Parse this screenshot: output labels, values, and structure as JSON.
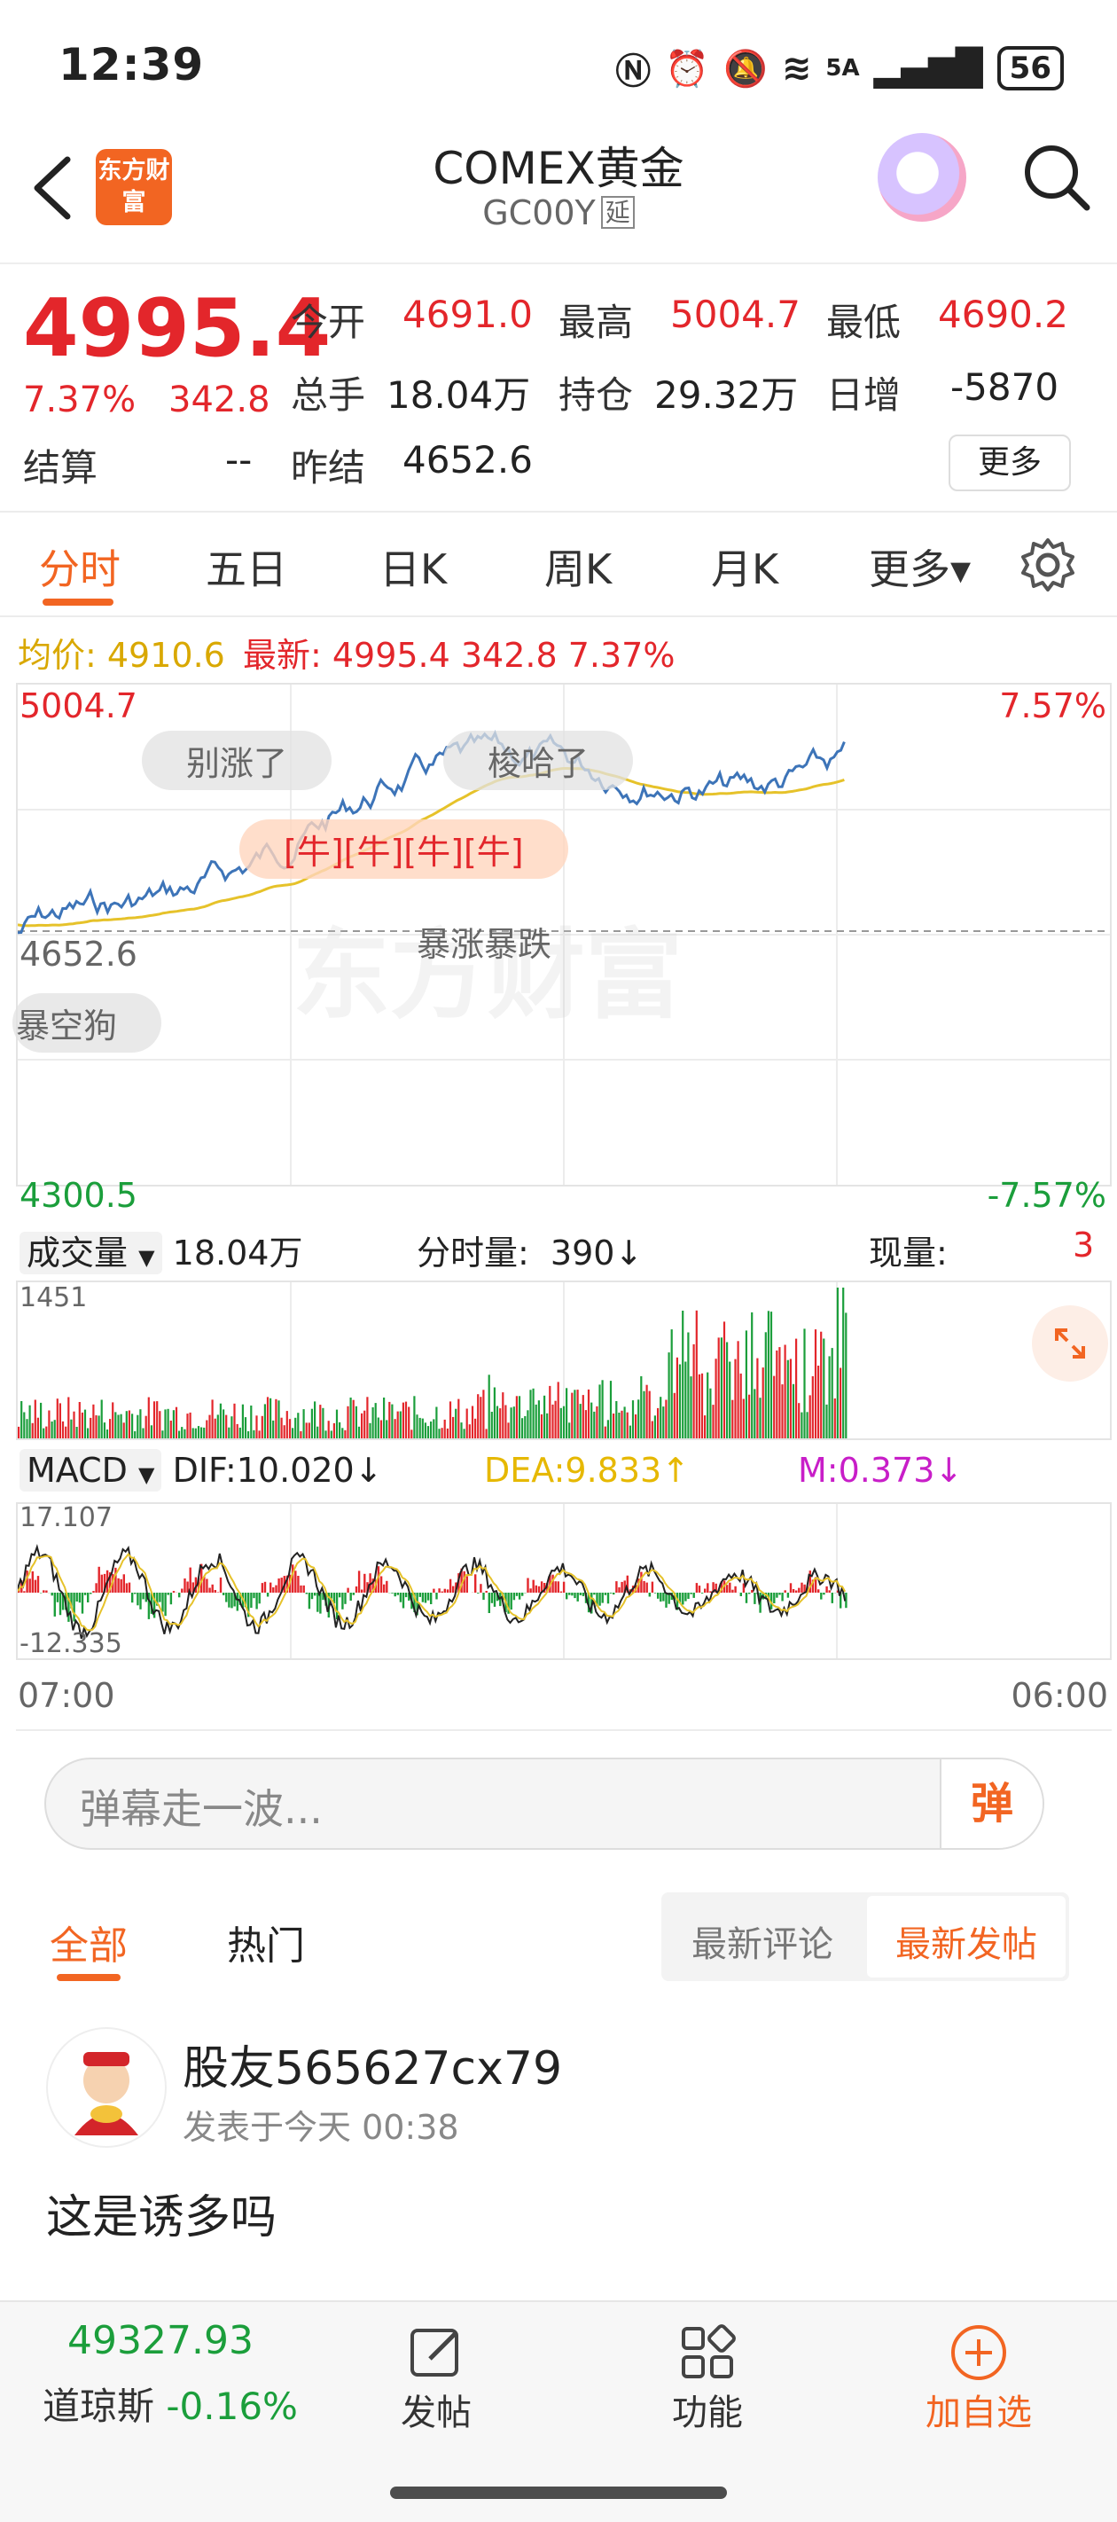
{
  "status_bar": {
    "time": "12:39",
    "network": "5A",
    "battery": "56"
  },
  "header": {
    "logo_text": "东方财富",
    "title": "COMEX黄金",
    "code": "GC00Y",
    "delay_badge": "延"
  },
  "quote": {
    "price": "4995.4",
    "change_pct": "7.37%",
    "change_amt": "342.8",
    "open_label": "今开",
    "open": "4691.0",
    "high_label": "最高",
    "high": "5004.7",
    "low_label": "最低",
    "low": "4690.2",
    "volume_label": "总手",
    "volume": "18.04万",
    "oi_label": "持仓",
    "oi": "29.32万",
    "daily_inc_label": "日增",
    "daily_inc": "-5870",
    "settle_label": "结算",
    "settle": "--",
    "prev_settle_label": "昨结",
    "prev_settle": "4652.6",
    "more_button": "更多"
  },
  "tabs": {
    "items": [
      "分时",
      "五日",
      "日K",
      "周K",
      "月K",
      "更多▾"
    ],
    "active": 0
  },
  "chart": {
    "avg_label": "均价: 4910.6",
    "latest_label": "最新: 4995.4 342.8 7.37%",
    "y_top": "5004.7",
    "y_bottom": "4300.5",
    "y_mid": "4652.6",
    "pct_top": "7.57%",
    "pct_bottom": "-7.57%",
    "bubbles": [
      "别涨了",
      "梭哈了",
      "[牛][牛][牛][牛]",
      "暴涨暴跌",
      "暴空狗"
    ],
    "watermark": "东方财富",
    "colors": {
      "price": "#3d74b8",
      "avg": "#e6c22a",
      "up": "#e3262b",
      "down": "#1b9e3b",
      "accent": "#f26522"
    }
  },
  "volume": {
    "selector": "成交量",
    "total": "18.04万",
    "tick_label": "分时量:",
    "tick_value": "390↓",
    "now_label": "现量:",
    "now_value": "3",
    "max_label": "1451"
  },
  "macd": {
    "selector": "MACD",
    "dif": "DIF:10.020↓",
    "dea": "DEA:9.833↑",
    "m": "M:0.373↓",
    "top_label": "17.107",
    "bottom_label": "-12.335",
    "x_start": "07:00",
    "x_end": "06:00"
  },
  "danmu": {
    "placeholder": "弹幕走一波...",
    "button": "弹"
  },
  "comments": {
    "tab_all": "全部",
    "tab_hot": "热门",
    "seg_latest_comment": "最新评论",
    "seg_latest_post": "最新发帖"
  },
  "post": {
    "username": "股友565627cx79",
    "time": "发表于今天 00:38",
    "body": "这是诱多吗"
  },
  "bottom_bar": {
    "dj_value": "49327.93",
    "dj_name": "道琼斯",
    "dj_change": "-0.16%",
    "post_label": "发帖",
    "func_label": "功能",
    "add_label": "加自选"
  }
}
